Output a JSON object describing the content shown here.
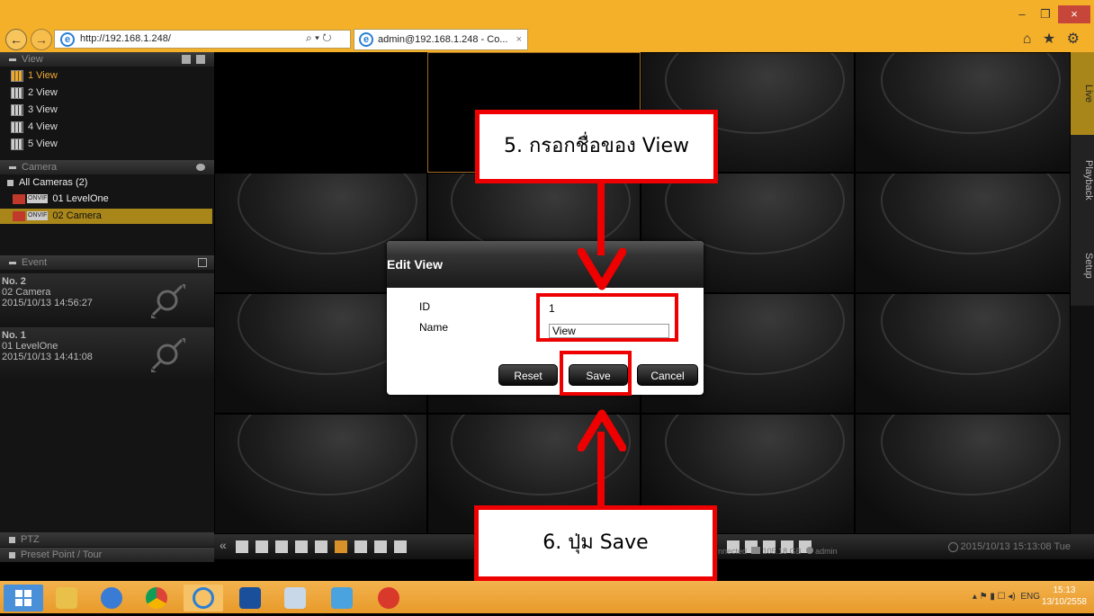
{
  "browser": {
    "url": "http://192.168.1.248/",
    "addr_controls": "⌕ ▾ ↻",
    "tab_title": "admin@192.168.1.248 - Co...",
    "tab_close": "×",
    "win_min": "–",
    "win_max": "❐",
    "win_close": "×",
    "right_icons": "⌂ ★ ⚙"
  },
  "sidebar": {
    "view_header": "View",
    "views": [
      "1 View",
      "2 View",
      "3 View",
      "4 View",
      "5 View"
    ],
    "camera_header": "Camera",
    "all_cameras": "All Cameras (2)",
    "cameras": [
      {
        "rec": "REC",
        "onvif": "ONVIF",
        "label": "01  LevelOne"
      },
      {
        "rec": "REC",
        "onvif": "ONVIF",
        "label": "02  Camera"
      }
    ],
    "event_header": "Event",
    "events": [
      {
        "no": "No. 2",
        "camera": "02 Camera",
        "time": "2015/10/13 14:56:27"
      },
      {
        "no": "No. 1",
        "camera": "01 LevelOne",
        "time": "2015/10/13 14:41:08"
      }
    ],
    "ptz_header": "PTZ",
    "preset_header": "Preset Point / Tour"
  },
  "right_tabs": [
    "Live",
    "Playback",
    "Setup"
  ],
  "toolbar": {
    "collapse": "«",
    "status_connected": "nnected",
    "storage": "105.18 GB",
    "user": "admin",
    "datetime": "2015/10/13 15:13:08 Tue"
  },
  "dialog": {
    "title": "Edit View",
    "id_label": "ID",
    "id_value": "1",
    "name_label": "Name",
    "name_value": "View",
    "reset": "Reset",
    "save": "Save",
    "cancel": "Cancel"
  },
  "annotations": {
    "callout_top": "5. กรอกชื่อของ View",
    "callout_bottom": "6. ปุ่ม Save"
  },
  "taskbar": {
    "tray_lang": "ENG",
    "clock_time": "15:13",
    "clock_date": "13/10/2558"
  },
  "colors": {
    "accent": "#f0a830",
    "annotation_red": "#e00000",
    "browser_chrome": "#f5b02a"
  }
}
